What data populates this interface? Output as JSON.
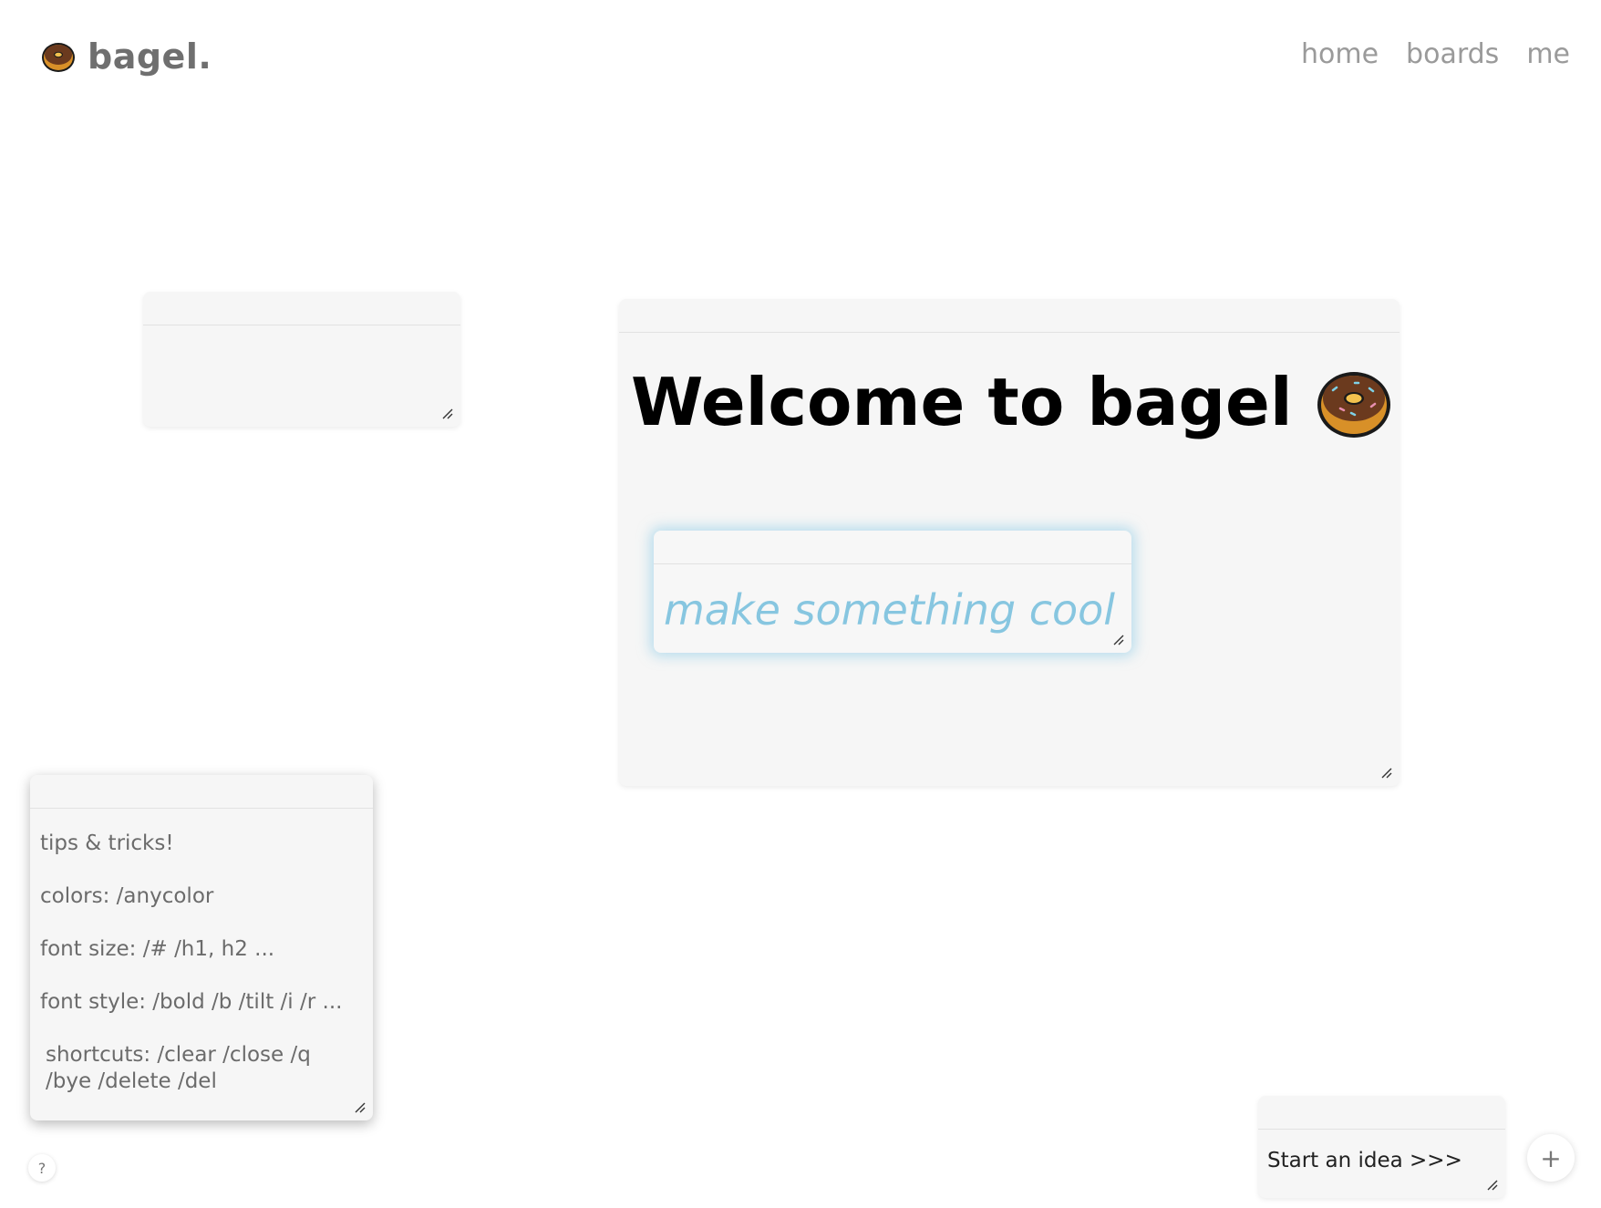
{
  "brand": {
    "name": "bagel.",
    "logo_icon": "donut-icon"
  },
  "nav": {
    "items": [
      "home",
      "boards",
      "me"
    ]
  },
  "main_card": {
    "title": "Welcome to bagel",
    "title_suffix": ".",
    "inner_input_text": "make something cool"
  },
  "tips_card": {
    "lines": [
      "tips & tricks!",
      "colors: /anycolor",
      "font size: /# /h1, h2 ...",
      "font style: /bold /b /tilt /i /r ...",
      "shortcuts: /clear /close /q /bye /delete /del"
    ]
  },
  "idea_card": {
    "text": "Start an idea >>>"
  },
  "buttons": {
    "help_label": "?",
    "add_label": "+"
  },
  "colors": {
    "accent_text": "#87c6e0",
    "card_bg": "#f6f6f6",
    "nav_text": "#9a9a9a"
  }
}
